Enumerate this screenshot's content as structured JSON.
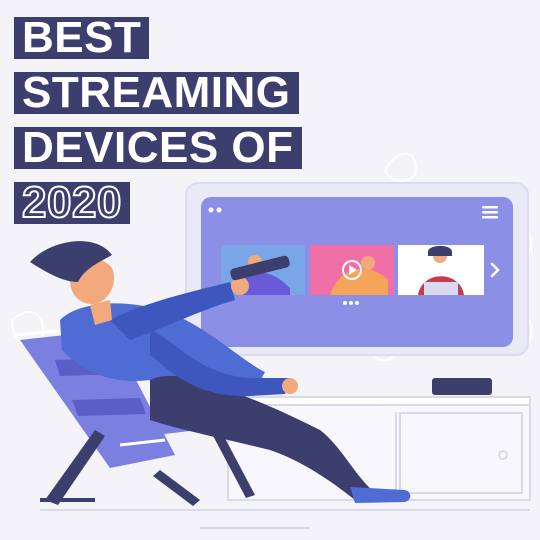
{
  "title": {
    "line1": "BEST",
    "line2": "STREAMING",
    "line3": "DEVICES OF",
    "line4": "2020"
  },
  "icons": {
    "tv_menu": "hamburger-menu-icon",
    "tv_next": "chevron-right-icon",
    "play": "play-icon",
    "pager": "pagination-dots-icon"
  },
  "colors": {
    "background": "#f3f3f8",
    "title_bg": "#3c3f6e",
    "screen": "#8b8fe6",
    "tv_frame": "#e9e9f7",
    "shirt": "#4f6bd4",
    "pants": "#3c3f6e",
    "chair": "#7a7fe0"
  }
}
